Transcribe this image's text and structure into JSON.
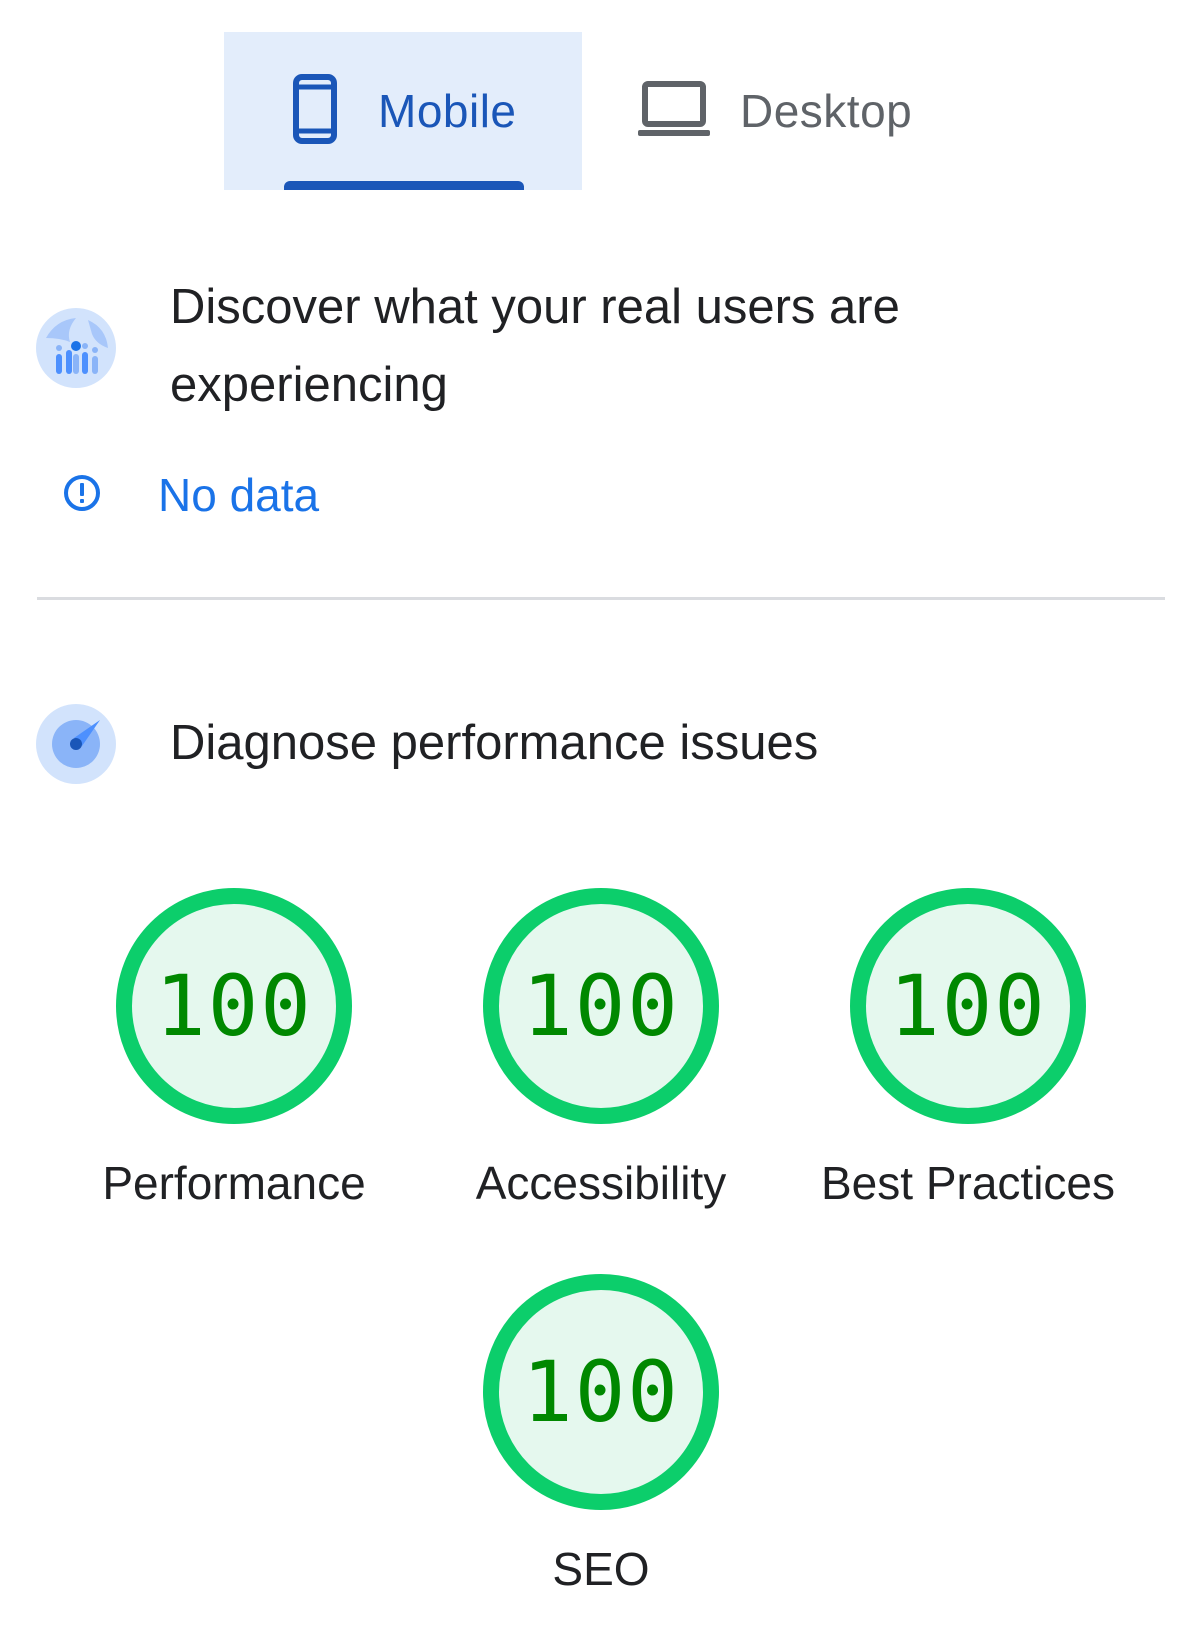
{
  "tabs": [
    {
      "label": "Mobile",
      "icon": "smartphone-icon",
      "selected": true
    },
    {
      "label": "Desktop",
      "icon": "laptop-icon",
      "selected": false
    }
  ],
  "field_data": {
    "title": "Discover what your real users are experiencing",
    "icon": "crux-users-icon",
    "status_icon": "info-circle-icon",
    "status_text": "No data"
  },
  "lab_data": {
    "title": "Diagnose performance issues",
    "icon": "lighthouse-compass-icon",
    "scores": [
      {
        "label": "Performance",
        "value": "100"
      },
      {
        "label": "Accessibility",
        "value": "100"
      },
      {
        "label": "Best Practices",
        "value": "100"
      },
      {
        "label": "SEO",
        "value": "100"
      }
    ]
  },
  "colors": {
    "accent_blue": "#1a56b8",
    "link_blue": "#1a73e8",
    "pass_green": "#0cce6b",
    "pass_text": "#008800",
    "pass_fill": "#e5f8ee",
    "tab_selected_bg": "#e3edfb"
  }
}
